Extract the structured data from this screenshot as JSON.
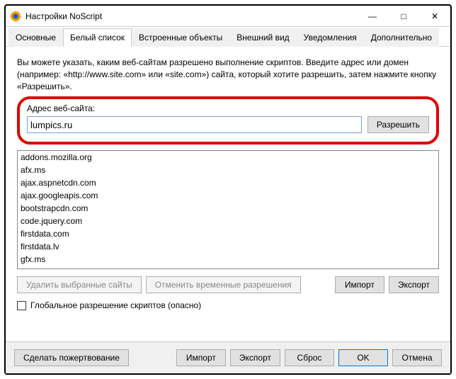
{
  "window": {
    "title": "Настройки NoScript",
    "minimize": "—",
    "maximize": "□",
    "close": "✕"
  },
  "tabs": {
    "t0": "Основные",
    "t1": "Белый список",
    "t2": "Встроенные объекты",
    "t3": "Внешний вид",
    "t4": "Уведомления",
    "t5": "Дополнительно"
  },
  "desc": "Вы можете указать, каким веб-сайтам разрешено выполнение скриптов. Введите адрес или домен (например: «http://www.site.com» или «site.com») сайта, который хотите разрешить, затем нажмите кнопку «Разрешить».",
  "form": {
    "label": "Адрес веб-сайта:",
    "value": "lumpics.ru",
    "allow_btn": "Разрешить"
  },
  "sites": {
    "s0": "addons.mozilla.org",
    "s1": "afx.ms",
    "s2": "ajax.aspnetcdn.com",
    "s3": "ajax.googleapis.com",
    "s4": "bootstrapcdn.com",
    "s5": "code.jquery.com",
    "s6": "firstdata.com",
    "s7": "firstdata.lv",
    "s8": "gfx.ms"
  },
  "actions": {
    "remove": "Удалить выбранные сайты",
    "revoke": "Отменить временные разрешения",
    "import": "Импорт",
    "export": "Экспорт"
  },
  "checkbox_label": "Глобальное разрешение скриптов (опасно)",
  "bottom": {
    "donate": "Сделать пожертвование",
    "import": "Импорт",
    "export": "Экспорт",
    "reset": "Сброс",
    "ok": "OK",
    "cancel": "Отмена"
  }
}
